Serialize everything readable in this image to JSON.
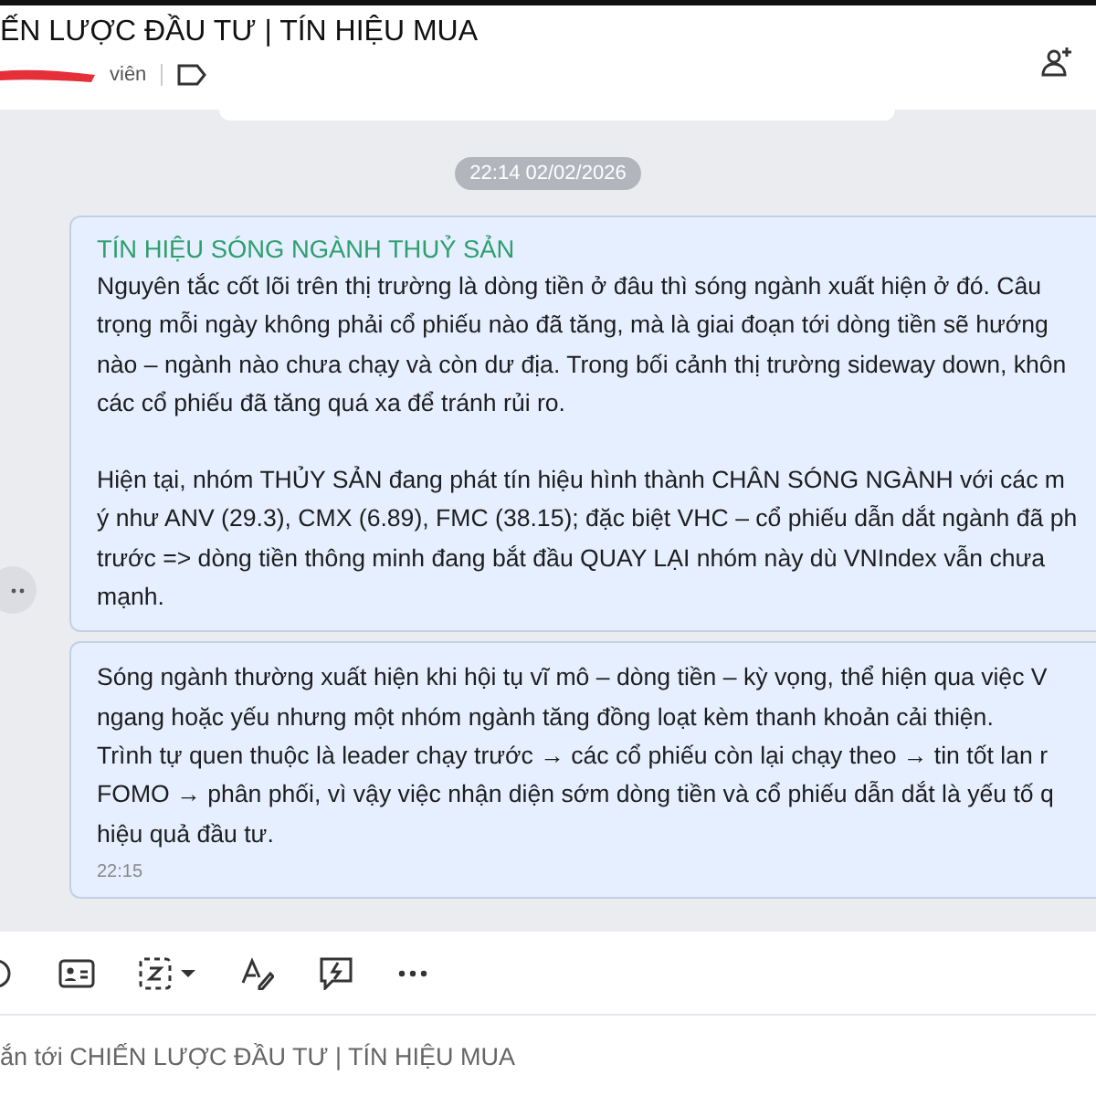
{
  "header": {
    "title": "ẾN LƯỢC ĐẦU TƯ | TÍN HIỆU MUA",
    "subtitle": "viên"
  },
  "date_divider": "22:14 02/02/2026",
  "messages": [
    {
      "title": "TÍN HIỆU SÓNG NGÀNH THUỶ SẢN",
      "paragraphs": [
        [
          "Nguyên tắc cốt lõi trên thị trường là dòng tiền ở đâu thì sóng ngành xuất hiện ở đó. Câu",
          "trọng mỗi ngày không phải cổ phiếu nào đã tăng, mà là giai đoạn tới dòng tiền sẽ hướng",
          "nào – ngành nào chưa chạy và còn dư địa. Trong bối cảnh thị trường sideway down, khôn",
          "các cổ phiếu đã tăng quá xa để tránh rủi ro."
        ],
        [
          "Hiện tại, nhóm THỦY SẢN đang phát tín hiệu hình thành CHÂN SÓNG NGÀNH với các m",
          "ý như ANV (29.3), CMX (6.89), FMC (38.15); đặc biệt VHC – cổ phiếu dẫn dắt ngành đã ph",
          "trước => dòng tiền thông minh đang bắt đầu QUAY LẠI nhóm này dù VNIndex vẫn chưa",
          "mạnh."
        ]
      ]
    },
    {
      "paragraphs": [
        [
          "Sóng ngành thường xuất hiện khi hội tụ vĩ mô – dòng tiền – kỳ vọng, thể hiện qua việc V",
          "ngang hoặc yếu nhưng một nhóm ngành tăng đồng loạt kèm thanh khoản cải thiện.",
          "Trình tự quen thuộc là leader chạy trước → các cổ phiếu còn lại chạy theo → tin tốt lan r",
          "FOMO → phân phối, vì vậy việc nhận diện sớm dòng tiền và cổ phiếu dẫn dắt là yếu tố q",
          "hiệu quả đầu tư."
        ]
      ],
      "time": "22:15"
    }
  ],
  "composer": {
    "placeholder": "ắn tới CHIẾN LƯỢC ĐẦU TƯ | TÍN HIỆU MUA"
  }
}
